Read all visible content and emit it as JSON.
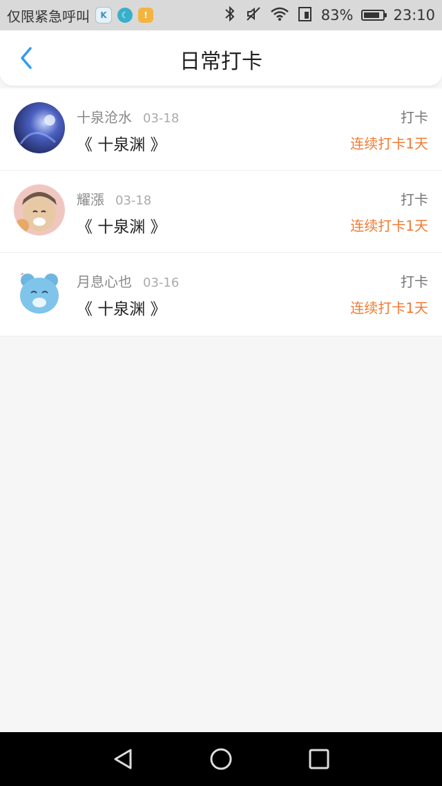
{
  "status_bar": {
    "carrier_text": "仅限紧急呼叫",
    "app_icons": [
      "k-icon",
      "moon-icon",
      "notification-icon"
    ],
    "battery_percent": "83%",
    "battery_level": 0.83,
    "time": "23:10"
  },
  "header": {
    "title": "日常打卡",
    "back_icon": "chevron-left-icon",
    "accent_color": "#2e9bf0"
  },
  "checkins": [
    {
      "username": "十泉沧水",
      "date": "03-18",
      "book": "《 十泉渊 》",
      "action": "打卡",
      "streak": "连续打卡1天"
    },
    {
      "username": "耀漲",
      "date": "03-18",
      "book": "《 十泉渊 》",
      "action": "打卡",
      "streak": "连续打卡1天"
    },
    {
      "username": "月息心也",
      "date": "03-16",
      "book": "《 十泉渊 》",
      "action": "打卡",
      "streak": "连续打卡1天"
    }
  ],
  "colors": {
    "streak": "#f27a32",
    "background": "#f6f6f6"
  },
  "nav_bar": {
    "icons": [
      "back-triangle-icon",
      "home-circle-icon",
      "recents-square-icon"
    ]
  }
}
